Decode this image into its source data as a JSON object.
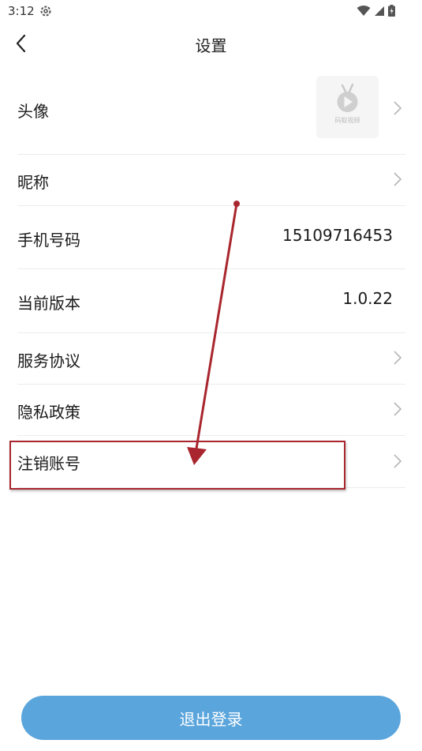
{
  "status_bar": {
    "time": "3:12",
    "icons": [
      "settings-gear-icon",
      "wifi-icon",
      "signal-icon",
      "battery-icon"
    ]
  },
  "header": {
    "title": "设置",
    "back_icon": "chevron-left-icon"
  },
  "rows": [
    {
      "label": "头像",
      "value": "",
      "has_chevron": true,
      "avatar_caption": "码蚁视频"
    },
    {
      "label": "昵称",
      "value": "",
      "has_chevron": true
    },
    {
      "label": "手机号码",
      "value": "15109716453",
      "has_chevron": false
    },
    {
      "label": "当前版本",
      "value": "1.0.22",
      "has_chevron": false
    },
    {
      "label": "服务协议",
      "value": "",
      "has_chevron": true
    },
    {
      "label": "隐私政策",
      "value": "",
      "has_chevron": true
    },
    {
      "label": "注销账号",
      "value": "",
      "has_chevron": true
    }
  ],
  "footer": {
    "logout_label": "退出登录"
  },
  "colors": {
    "logout_button": "#5aa5dc",
    "annotation_red": "#a9262e",
    "divider": "#ececec"
  }
}
